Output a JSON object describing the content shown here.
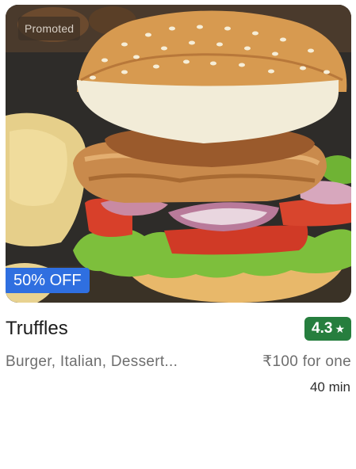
{
  "card": {
    "promoted_label": "Promoted",
    "discount_label": "50% OFF",
    "restaurant_name": "Truffles",
    "rating": "4.3",
    "rating_icon": "star-icon",
    "cuisines": "Burger, Italian, Dessert...",
    "price_for_one": "₹100 for one",
    "delivery_time": "40 min",
    "colors": {
      "rating_bg": "#267e3e",
      "discount_bg": "#2f6fe0"
    }
  }
}
